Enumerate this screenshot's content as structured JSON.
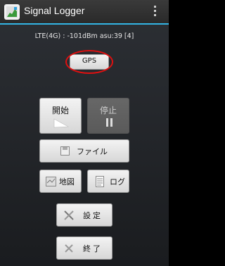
{
  "app": {
    "title": "Signal Logger"
  },
  "status": {
    "text": "LTE(4G) : -101dBm asu:39 [4]"
  },
  "buttons": {
    "gps": "GPS",
    "start": "開始",
    "stop": "停止",
    "file": "ファイル",
    "map": "地図",
    "log": "ログ",
    "settings": "設定",
    "exit": "終了"
  },
  "colors": {
    "accent": "#33b5e5",
    "highlight_ring": "#e01010",
    "actionbar": "#2f2f2f"
  },
  "icons": [
    "app-icon",
    "overflow-menu-icon",
    "play-icon",
    "pause-icon",
    "file-icon",
    "map-icon",
    "log-icon",
    "tools-icon",
    "close-icon"
  ]
}
